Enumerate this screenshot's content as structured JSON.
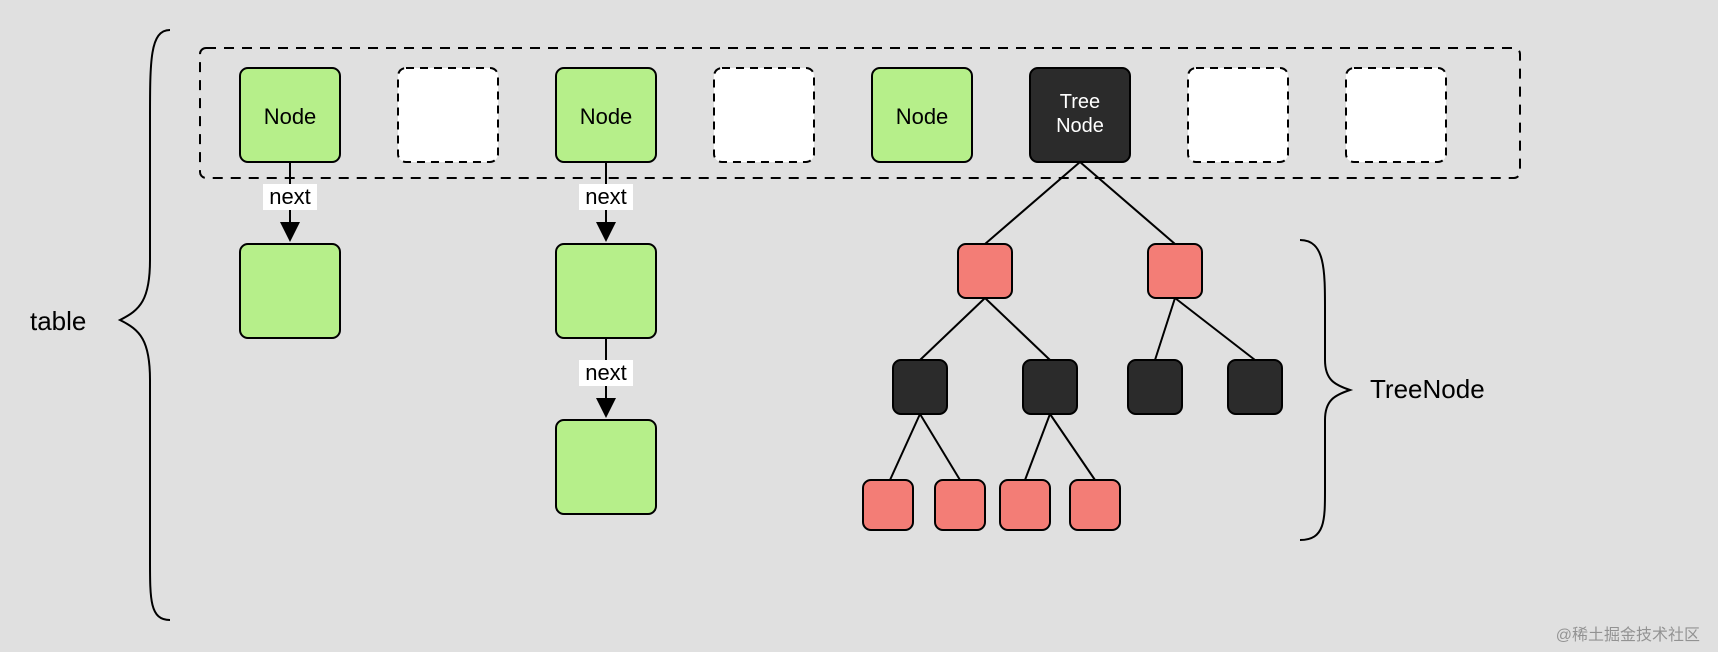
{
  "labels": {
    "table": "table",
    "treeNodeLabel": "TreeNode",
    "nextLabel": "next",
    "nodeLabel": "Node",
    "treeNodeSlot1": "Tree",
    "treeNodeSlot2": "Node",
    "watermark": "@稀土掘金技术社区"
  },
  "colors": {
    "green": "#b6ef8a",
    "black": "#2b2b2b",
    "red": "#f37d76",
    "empty": "#ffffff",
    "bg": "#e0e0e0"
  },
  "structure": {
    "arraySlots": [
      {
        "type": "green",
        "label": "Node"
      },
      {
        "type": "empty"
      },
      {
        "type": "green",
        "label": "Node"
      },
      {
        "type": "empty"
      },
      {
        "type": "green",
        "label": "Node"
      },
      {
        "type": "black",
        "label": "TreeNode"
      },
      {
        "type": "empty"
      },
      {
        "type": "empty"
      }
    ],
    "linkedListChains": [
      {
        "slot": 0,
        "length": 1
      },
      {
        "slot": 2,
        "length": 2
      }
    ],
    "rbTree": {
      "rootSlot": 5,
      "levels": [
        {
          "color": "red",
          "count": 2
        },
        {
          "color": "black",
          "count": 4
        },
        {
          "color": "red",
          "count": 4,
          "onlyLeftTwo": true
        }
      ]
    }
  }
}
